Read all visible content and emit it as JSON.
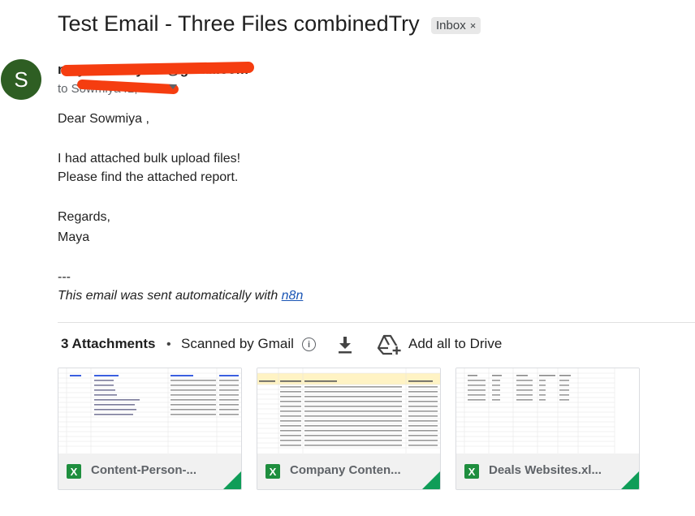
{
  "email": {
    "subject": "Test Email - Three Files combinedTry",
    "label": "Inbox",
    "label_remove": "×",
    "avatar_letter": "S",
    "sender": "mayasowmiya41@gmail.com",
    "to": "to Sowmiya41,"
  },
  "body": {
    "greeting": "Dear Sowmiya ,",
    "line1": "I had attached bulk upload files!",
    "line2": "Please find the attached report.",
    "regards": "Regards,",
    "signature": "Maya",
    "separator": "---",
    "auto_text": "This email was sent automatically with ",
    "auto_link": "n8n"
  },
  "attachments": {
    "title": "3 Attachments",
    "dot": "•",
    "scanned": "Scanned by Gmail",
    "info_symbol": "i",
    "add_to_drive": "Add all to Drive",
    "files": [
      {
        "name": "Content-Person-...",
        "icon": "excel-icon"
      },
      {
        "name": "Company Conten...",
        "icon": "excel-icon"
      },
      {
        "name": "Deals Websites.xl...",
        "icon": "excel-icon"
      }
    ]
  },
  "colors": {
    "avatar": "#2e5e23",
    "link": "#1a55b5",
    "excel": "#1e8e3e",
    "redaction": "#f53d10"
  }
}
